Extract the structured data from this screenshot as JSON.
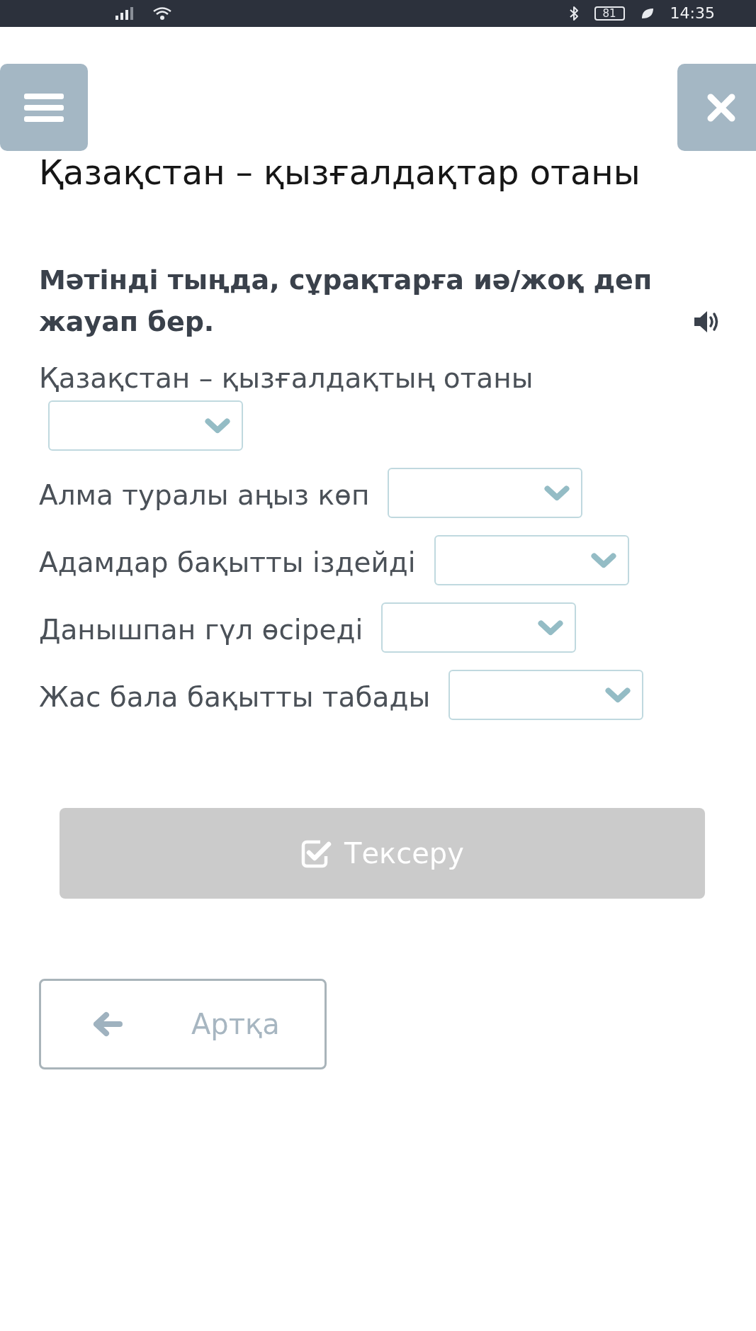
{
  "status_bar": {
    "battery": "81",
    "time": "14:35"
  },
  "title": "Қазақстан – қызғалдақтар отаны",
  "instruction": "Мәтінді тыңда, сұрақтарға иә/жоқ деп жауап бер.",
  "questions": [
    {
      "text": "Қазақстан – қызғалдақтың отаны"
    },
    {
      "text": "Алма туралы аңыз көп"
    },
    {
      "text": "Адамдар бақытты іздейді"
    },
    {
      "text": "Данышпан гүл өсіреді"
    },
    {
      "text": "Жас бала бақытты табады"
    }
  ],
  "check_button": {
    "label": "Тексеру",
    "disabled": true
  },
  "back_button": {
    "label": "Артқа"
  }
}
